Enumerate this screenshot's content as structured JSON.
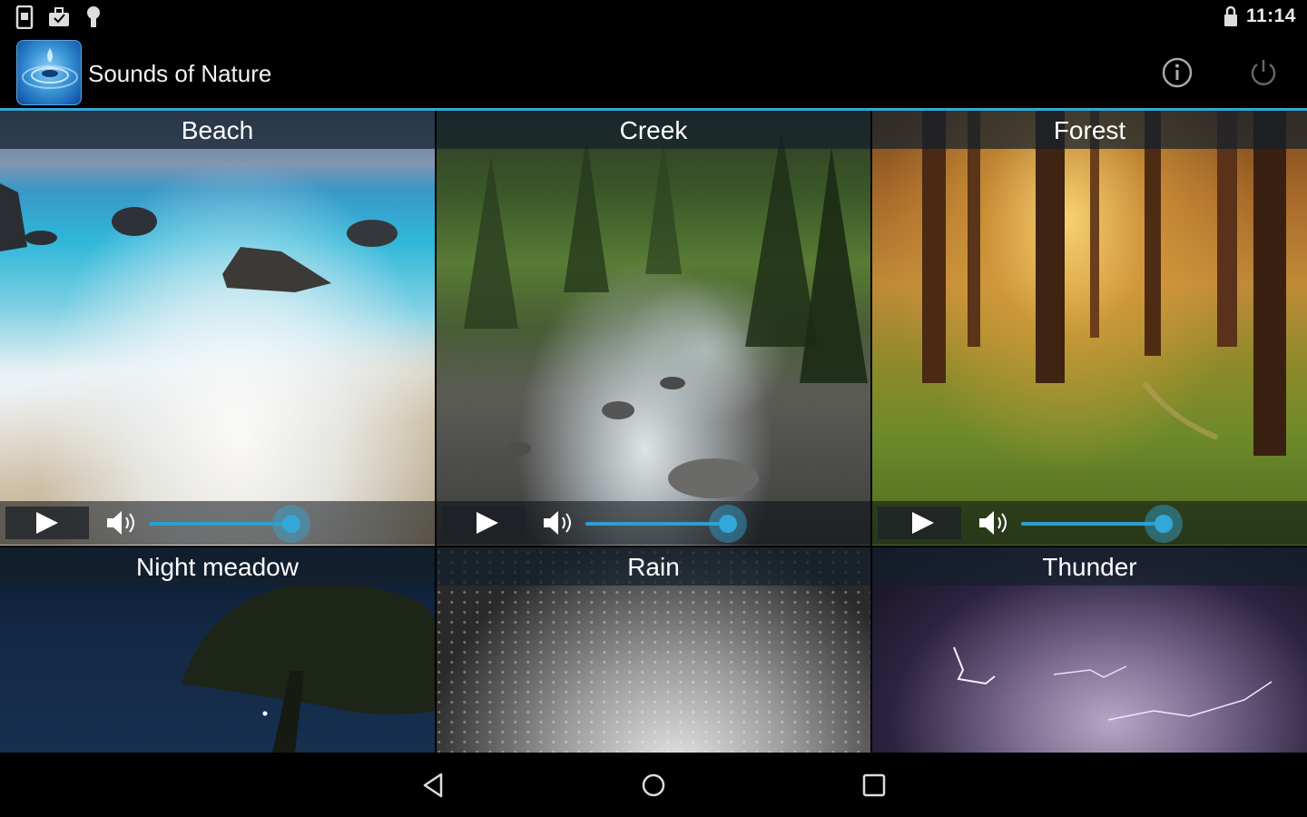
{
  "status_bar": {
    "time": "11:14",
    "icons": [
      "phone-icon",
      "suitcase-icon",
      "android-icon",
      "lock-icon"
    ]
  },
  "app": {
    "title": "Sounds of Nature",
    "accent_color": "#33a7d8",
    "actions": [
      "info-icon",
      "power-icon"
    ]
  },
  "sounds": [
    {
      "title": "Beach",
      "volume": 1.0
    },
    {
      "title": "Creek",
      "volume": 1.0
    },
    {
      "title": "Forest",
      "volume": 1.0
    },
    {
      "title": "Night meadow"
    },
    {
      "title": "Rain"
    },
    {
      "title": "Thunder"
    }
  ],
  "nav_bar": {
    "buttons": [
      "back-icon",
      "home-icon",
      "recents-icon"
    ]
  }
}
